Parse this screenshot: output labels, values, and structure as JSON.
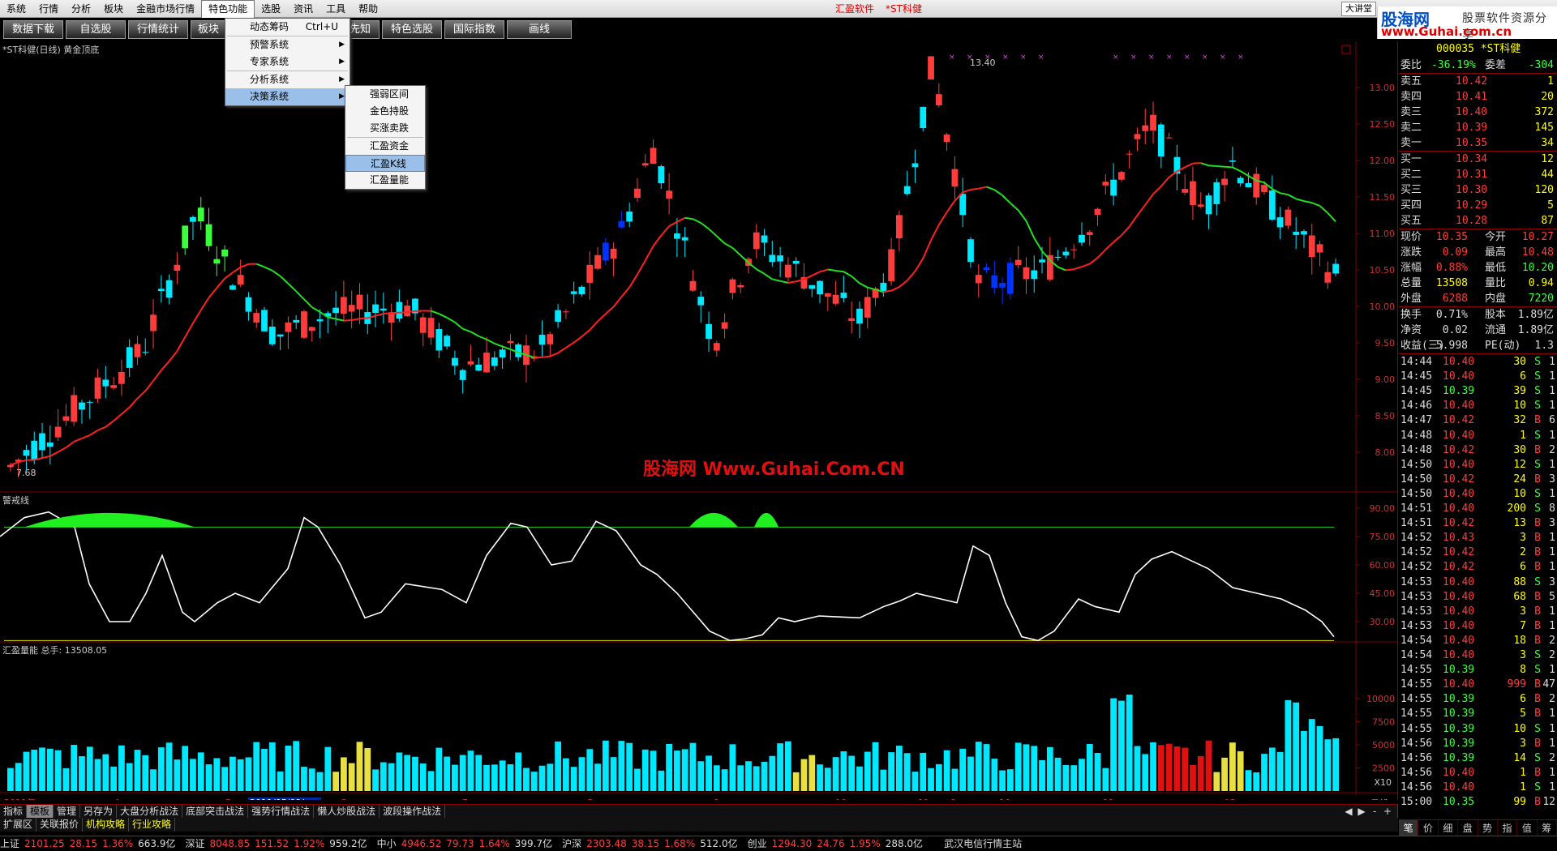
{
  "menubar": [
    "系统",
    "行情",
    "分析",
    "板块",
    "金融市场行情",
    "特色功能",
    "选股",
    "资讯",
    "工具",
    "帮助"
  ],
  "menubar_center": [
    "汇盈软件",
    "*ST科健"
  ],
  "menubar_right": "大讲堂",
  "toolbar": [
    "数据下载",
    "自选股",
    "行情统计",
    "板块",
    "牛熊先知",
    "特色选股",
    "国际指数",
    "画线"
  ],
  "logo": {
    "text1": "股海网",
    "text2": "股票软件资源分享",
    "text3": "www.Guhai.com.cn"
  },
  "menu1": [
    {
      "label": "动态筹码",
      "shortcut": "Ctrl+U"
    },
    {
      "label": "预警系统",
      "arrow": "▶"
    },
    {
      "label": "专家系统",
      "arrow": "▶"
    },
    {
      "label": "分析系统",
      "arrow": "▶"
    },
    {
      "label": "决策系统",
      "arrow": "▶"
    }
  ],
  "menu2": [
    "强弱区间",
    "金色持股",
    "买涨卖跌",
    "汇盈资金",
    "汇盈K线",
    "汇盈量能"
  ],
  "main_title": "*ST科健(日线) 黄金顶底",
  "watermark": "股海网 Www.Guhai.Com.CN",
  "annotations": {
    "high": "13.40",
    "low": "7.68"
  },
  "price_axis": [
    "13.00",
    "12.50",
    "12.00",
    "11.50",
    "11.00",
    "10.50",
    "10.00",
    "9.50",
    "9.00",
    "8.50",
    "8.00"
  ],
  "ind_title": "警戒线",
  "ind_axis": [
    "90.00",
    "75.00",
    "60.00",
    "45.00",
    "30.00"
  ],
  "vol_title": "汇盈量能 总手: 13508.05",
  "vol_axis": [
    "10000",
    "7500",
    "5000",
    "2500"
  ],
  "vol_unit": "X10",
  "date_axis": [
    "2011年",
    "4",
    "5",
    "2011/05/09/一",
    "6",
    "7",
    "8",
    "9",
    "10",
    "11",
    "9",
    "10",
    "11",
    "12"
  ],
  "date_label_right": "日线",
  "right_panel": {
    "code": "000035",
    "name": "*ST科健",
    "weibi_label": "委比",
    "weibi": "-36.19%",
    "weicha_label": "委差",
    "weicha": "-304",
    "asks": [
      {
        "l": "卖五",
        "p": "10.42",
        "v": "1"
      },
      {
        "l": "卖四",
        "p": "10.41",
        "v": "20"
      },
      {
        "l": "卖三",
        "p": "10.40",
        "v": "372"
      },
      {
        "l": "卖二",
        "p": "10.39",
        "v": "145"
      },
      {
        "l": "卖一",
        "p": "10.35",
        "v": "34"
      }
    ],
    "bids": [
      {
        "l": "买一",
        "p": "10.34",
        "v": "12"
      },
      {
        "l": "买二",
        "p": "10.31",
        "v": "44"
      },
      {
        "l": "买三",
        "p": "10.30",
        "v": "120"
      },
      {
        "l": "买四",
        "p": "10.29",
        "v": "5"
      },
      {
        "l": "买五",
        "p": "10.28",
        "v": "87"
      }
    ],
    "stats": [
      {
        "a": "现价",
        "av": "10.35",
        "b": "今开",
        "bv": "10.27",
        "ac": "r",
        "bc": "r"
      },
      {
        "a": "涨跌",
        "av": "0.09",
        "b": "最高",
        "bv": "10.48",
        "ac": "r",
        "bc": "r"
      },
      {
        "a": "涨幅",
        "av": "0.88%",
        "b": "最低",
        "bv": "10.20",
        "ac": "r",
        "bc": "g"
      },
      {
        "a": "总量",
        "av": "13508",
        "b": "量比",
        "bv": "0.94",
        "ac": "y",
        "bc": "y"
      },
      {
        "a": "外盘",
        "av": "6288",
        "b": "内盘",
        "bv": "7220",
        "ac": "r",
        "bc": "g"
      }
    ],
    "stats2": [
      {
        "a": "换手",
        "av": "0.71%",
        "b": "股本",
        "bv": "1.89亿"
      },
      {
        "a": "净资",
        "av": "0.02",
        "b": "流通",
        "bv": "1.89亿"
      },
      {
        "a": "收益(三)",
        "av": "5.998",
        "b": "PE(动)",
        "bv": "1.3"
      }
    ],
    "ticks": [
      {
        "t": "14:44",
        "p": "10.40",
        "v": "30",
        "s": "S",
        "n": "1"
      },
      {
        "t": "14:45",
        "p": "10.40",
        "v": "6",
        "s": "S",
        "n": "1"
      },
      {
        "t": "14:45",
        "p": "10.39",
        "v": "39",
        "s": "S",
        "n": "1"
      },
      {
        "t": "14:46",
        "p": "10.40",
        "v": "10",
        "s": "S",
        "n": "1"
      },
      {
        "t": "14:47",
        "p": "10.42",
        "v": "32",
        "s": "B",
        "n": "6"
      },
      {
        "t": "14:48",
        "p": "10.40",
        "v": "1",
        "s": "S",
        "n": "1"
      },
      {
        "t": "14:48",
        "p": "10.42",
        "v": "30",
        "s": "B",
        "n": "2"
      },
      {
        "t": "14:50",
        "p": "10.40",
        "v": "12",
        "s": "S",
        "n": "1"
      },
      {
        "t": "14:50",
        "p": "10.42",
        "v": "24",
        "s": "B",
        "n": "3"
      },
      {
        "t": "14:50",
        "p": "10.40",
        "v": "10",
        "s": "S",
        "n": "1"
      },
      {
        "t": "14:51",
        "p": "10.40",
        "v": "200",
        "s": "S",
        "n": "8"
      },
      {
        "t": "14:51",
        "p": "10.42",
        "v": "13",
        "s": "B",
        "n": "3"
      },
      {
        "t": "14:52",
        "p": "10.43",
        "v": "3",
        "s": "B",
        "n": "1"
      },
      {
        "t": "14:52",
        "p": "10.42",
        "v": "2",
        "s": "B",
        "n": "1"
      },
      {
        "t": "14:52",
        "p": "10.42",
        "v": "6",
        "s": "B",
        "n": "1"
      },
      {
        "t": "14:53",
        "p": "10.40",
        "v": "88",
        "s": "S",
        "n": "3"
      },
      {
        "t": "14:53",
        "p": "10.40",
        "v": "68",
        "s": "B",
        "n": "5"
      },
      {
        "t": "14:53",
        "p": "10.40",
        "v": "3",
        "s": "B",
        "n": "1"
      },
      {
        "t": "14:53",
        "p": "10.40",
        "v": "7",
        "s": "B",
        "n": "1"
      },
      {
        "t": "14:54",
        "p": "10.40",
        "v": "18",
        "s": "B",
        "n": "2"
      },
      {
        "t": "14:54",
        "p": "10.40",
        "v": "3",
        "s": "S",
        "n": "2"
      },
      {
        "t": "14:55",
        "p": "10.39",
        "v": "8",
        "s": "S",
        "n": "1"
      },
      {
        "t": "14:55",
        "p": "10.40",
        "v": "999",
        "s": "B",
        "n": "47"
      },
      {
        "t": "14:55",
        "p": "10.39",
        "v": "6",
        "s": "B",
        "n": "2"
      },
      {
        "t": "14:55",
        "p": "10.39",
        "v": "5",
        "s": "B",
        "n": "1"
      },
      {
        "t": "14:55",
        "p": "10.39",
        "v": "10",
        "s": "S",
        "n": "1"
      },
      {
        "t": "14:56",
        "p": "10.39",
        "v": "3",
        "s": "B",
        "n": "1"
      },
      {
        "t": "14:56",
        "p": "10.39",
        "v": "14",
        "s": "S",
        "n": "2"
      },
      {
        "t": "14:56",
        "p": "10.40",
        "v": "1",
        "s": "B",
        "n": "1"
      },
      {
        "t": "14:56",
        "p": "10.40",
        "v": "1",
        "s": "S",
        "n": "1"
      },
      {
        "t": "15:00",
        "p": "10.35",
        "v": "99",
        "s": "B",
        "n": "12"
      }
    ],
    "tabs": [
      "笔",
      "价",
      "细",
      "盘",
      "势",
      "指",
      "值",
      "筹"
    ]
  },
  "tabbar1": [
    "指标",
    "模板",
    "管理",
    "另存为",
    "大盘分析战法",
    "底部突击战法",
    "强势行情战法",
    "懒人炒股战法",
    "波段操作战法"
  ],
  "tabbar1_controls": [
    "◀",
    "▶",
    "-",
    "+"
  ],
  "tabbar2": [
    "扩展区",
    "关联报价",
    "机构攻略",
    "行业攻略"
  ],
  "status": [
    {
      "name": "上证",
      "v1": "2101.25",
      "v2": "28.15",
      "v3": "1.36%",
      "amt": "663.9亿"
    },
    {
      "name": "深证",
      "v1": "8048.85",
      "v2": "151.52",
      "v3": "1.92%",
      "amt": "959.2亿"
    },
    {
      "name": "中小",
      "v1": "4946.52",
      "v2": "79.73",
      "v3": "1.64%",
      "amt": "399.7亿"
    },
    {
      "name": "沪深",
      "v1": "2303.48",
      "v2": "38.15",
      "v3": "1.68%",
      "amt": "512.0亿"
    },
    {
      "name": "创业",
      "v1": "1294.30",
      "v2": "24.76",
      "v3": "1.95%",
      "amt": "288.0亿"
    }
  ],
  "status_right": "武汉电信行情主站",
  "colors": {
    "up": "#ff3c3c",
    "down": "#00e8ff",
    "blue": "#0033ff",
    "green": "#3cff3c",
    "ma_red": "#ff2020",
    "ma_green": "#20e020",
    "bg": "#000",
    "grid": "#800000"
  }
}
